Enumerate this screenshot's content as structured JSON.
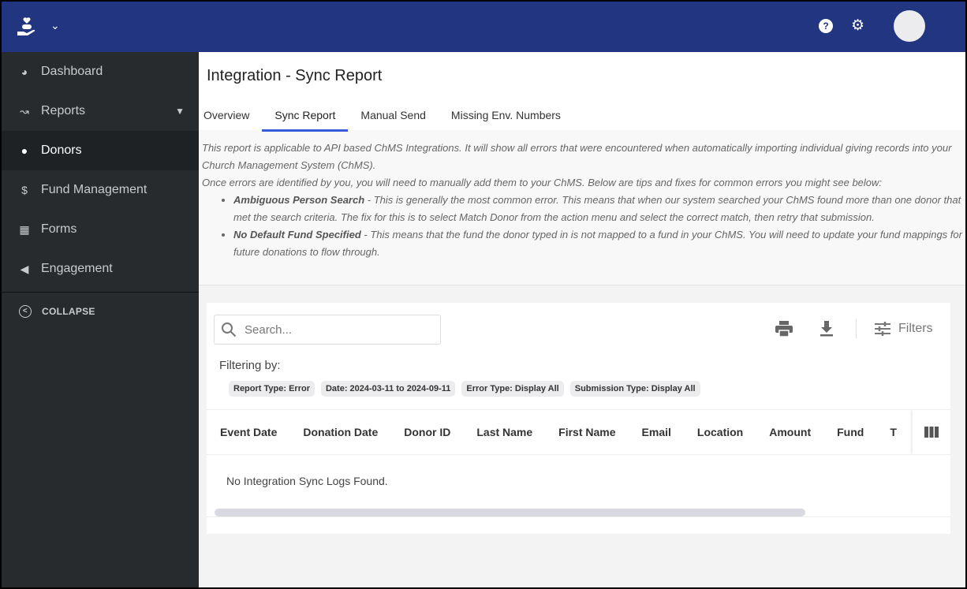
{
  "sidebar": {
    "items": [
      {
        "label": "Dashboard"
      },
      {
        "label": "Reports"
      },
      {
        "label": "Donors"
      },
      {
        "label": "Fund Management"
      },
      {
        "label": "Forms"
      },
      {
        "label": "Engagement"
      }
    ],
    "collapse": "COLLAPSE"
  },
  "page": {
    "title": "Integration - Sync Report",
    "tabs": [
      {
        "label": "Overview"
      },
      {
        "label": "Sync Report"
      },
      {
        "label": "Manual Send"
      },
      {
        "label": "Missing Env. Numbers"
      }
    ]
  },
  "info": {
    "p1": "This report is applicable to API based ChMS Integrations. It will show all errors that were encountered when automatically importing individual giving records into your Church Management System (ChMS).",
    "p2": "Once errors are identified by you, you will need to manually add them to your ChMS. Below are tips and fixes for common errors you might see below:",
    "tips": [
      {
        "title": "Ambiguous Person Search",
        "text": " - This is generally the most common error. This means that when our system searched your ChMS found more than one donor that met the search criteria. The fix for this is to select Match Donor from the action menu and select the correct match, then retry that submission."
      },
      {
        "title": "No Default Fund Specified",
        "text": " - This means that the fund the donor typed in is not mapped to a fund in your ChMS. You will need to update your fund mappings for future donations to flow through."
      }
    ]
  },
  "toolbar": {
    "search_placeholder": "Search...",
    "filters_label": "Filters"
  },
  "filtering": {
    "label": "Filtering by:",
    "chips": [
      "Report Type: Error",
      "Date: 2024-03-11 to 2024-09-11",
      "Error Type: Display All",
      "Submission Type: Display All"
    ]
  },
  "table": {
    "columns": [
      "Event Date",
      "Donation Date",
      "Donor ID",
      "Last Name",
      "First Name",
      "Email",
      "Location",
      "Amount",
      "Fund",
      "T"
    ],
    "empty": "No Integration Sync Logs Found."
  }
}
